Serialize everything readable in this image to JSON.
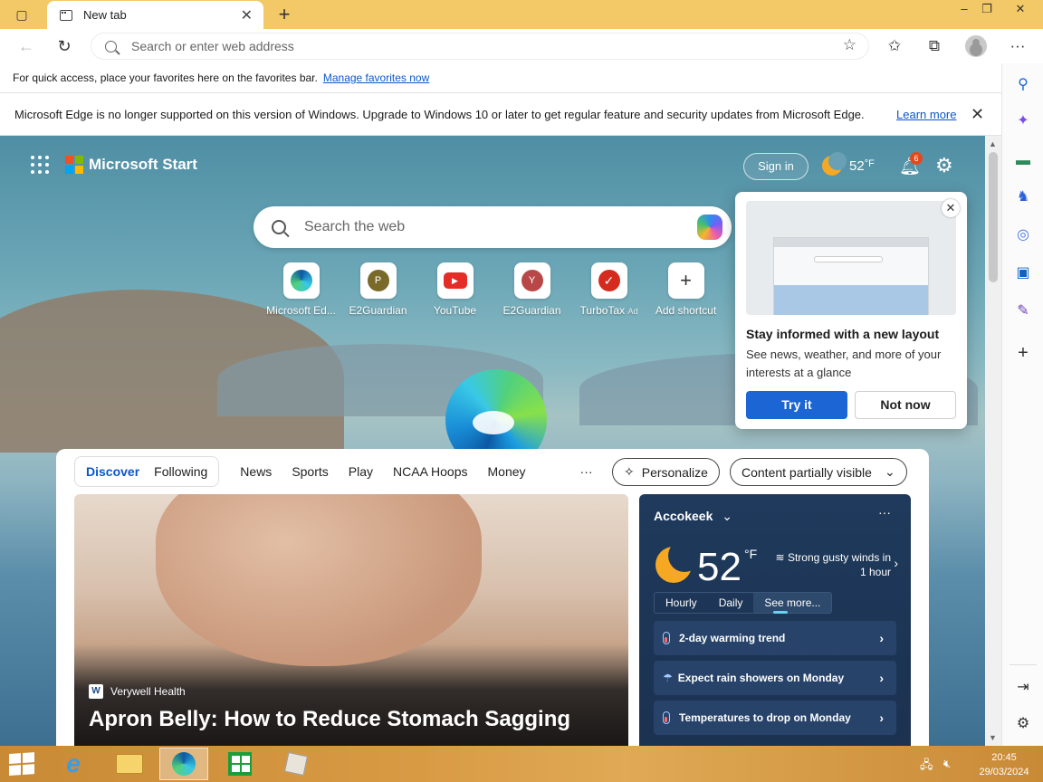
{
  "browser": {
    "tab_title": "New tab",
    "address_placeholder": "Search or enter web address",
    "window_controls": [
      "–",
      "❐",
      "✕"
    ]
  },
  "favorites_bar": {
    "text": "For quick access, place your favorites here on the favorites bar.",
    "link": "Manage favorites now"
  },
  "info_banner": {
    "message": "Microsoft Edge is no longer supported on this version of Windows. Upgrade to Windows 10 or later to get regular feature and security updates from Microsoft Edge.",
    "link": "Learn more"
  },
  "start_page": {
    "brand": "Microsoft Start",
    "sign_in": "Sign in",
    "temperature": "52",
    "temp_unit": "°F",
    "notifications_count": "6",
    "search_placeholder": "Search the web",
    "shortcuts": [
      {
        "label": "Microsoft Ed...",
        "icon": "edge-icon"
      },
      {
        "label": "E2Guardian",
        "icon": "letter-P",
        "letter": "P",
        "color": "#7a6a2a"
      },
      {
        "label": "YouTube",
        "icon": "youtube-icon"
      },
      {
        "label": "E2Guardian",
        "icon": "letter-Y",
        "letter": "Y",
        "color": "#b84848"
      },
      {
        "label": "TurboTax",
        "ad": "Ad",
        "icon": "turbotax-icon"
      },
      {
        "label": "Add shortcut",
        "icon": "plus-icon"
      }
    ]
  },
  "popup": {
    "title": "Stay informed with a new layout",
    "body": "See news, weather, and more of your interests at a glance",
    "primary": "Try it",
    "secondary": "Not now"
  },
  "feed": {
    "tabs_group": [
      "Discover",
      "Following"
    ],
    "tabs": [
      "News",
      "Sports",
      "Play",
      "NCAA Hoops",
      "Money"
    ],
    "more": "···",
    "personalize": "Personalize",
    "content_visibility": "Content partially visible",
    "hero": {
      "source": "Verywell Health",
      "source_logo": "W",
      "headline": "Apron Belly: How to Reduce Stomach Sagging"
    }
  },
  "weather_card": {
    "location": "Accokeek",
    "temperature": "52",
    "unit": "°F",
    "alert": "Strong gusty winds in 1 hour",
    "tabs": [
      "Hourly",
      "Daily",
      "See more..."
    ],
    "rows": [
      "2-day warming trend",
      "Expect rain showers on Monday",
      "Temperatures to drop on Monday"
    ]
  },
  "taskbar": {
    "time": "20:45",
    "date": "29/03/2024"
  },
  "colors": {
    "tabbar": "#f3c867",
    "accent": "#1b65d4",
    "link": "#0b57c8",
    "taskbar": "#d99a44",
    "weather_card": "#1f3a5c"
  }
}
